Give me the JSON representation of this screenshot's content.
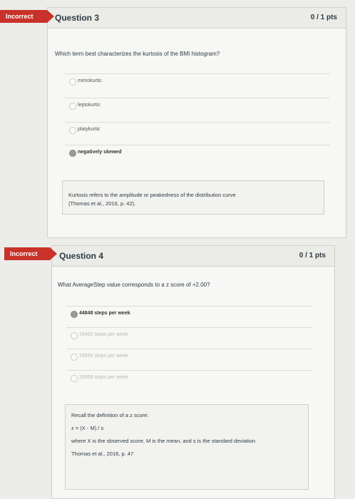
{
  "q3": {
    "status": "Incorrect",
    "title": "Question 3",
    "points": "0 / 1 pts",
    "prompt": "Which term best characterizes the kurtosis of the BMI histogram?",
    "options": [
      {
        "label": "mesokurtic",
        "selected": false
      },
      {
        "label": "leptokurtic",
        "selected": false
      },
      {
        "label": "platykurtic",
        "selected": false
      },
      {
        "label": "negatively skewed",
        "selected": true
      }
    ],
    "feedback": {
      "line1": "Kurtosis refers to the amplitude or peakedness of the distribution curve",
      "line2": "(Thomas et al., 2016, p. 42)."
    }
  },
  "q4": {
    "status": "Incorrect",
    "title": "Question 4",
    "points": "0 / 1 pts",
    "prompt": "What AverageStep value corresponds to a z score of +2.00?",
    "options": [
      {
        "label": "44848 steps per week",
        "selected": true
      },
      {
        "label": "16493 steps per week",
        "selected": false
      },
      {
        "label": "19555 steps per week",
        "selected": false
      },
      {
        "label": "20959 steps per week",
        "selected": false
      }
    ],
    "feedback": {
      "line1": "Recall the definition of a z score:",
      "line2": "z = (X - M) / s",
      "line3": "where X is the observed score, M is the mean, and s is the standard deviation",
      "line4": "Thomas et al., 2016, p. 47"
    }
  }
}
